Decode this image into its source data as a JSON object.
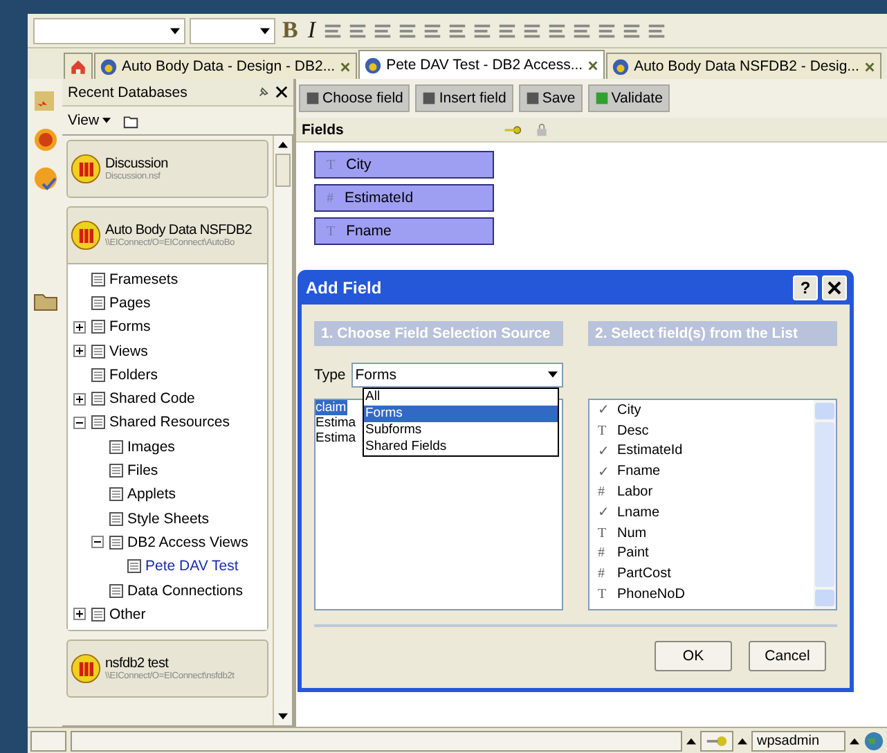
{
  "toolbar": {
    "format_buttons": [
      {
        "label": "B",
        "kind": "bold"
      },
      {
        "label": "I",
        "kind": "italic"
      }
    ]
  },
  "tabs": [
    {
      "label": "Auto Body Data - Design - DB2...",
      "selected": false
    },
    {
      "label": "Pete DAV Test - DB2 Access...",
      "selected": true
    },
    {
      "label": "Auto Body Data NSFDB2 - Desig...",
      "selected": false
    }
  ],
  "recent_databases": {
    "title": "Recent Databases",
    "view_menu": "View",
    "databases": [
      {
        "name": "Discussion",
        "path": "Discussion.nsf",
        "expanded": false
      },
      {
        "name": "Auto Body Data NSFDB2",
        "path": "\\\\EIConnect/O=EIConnect\\AutoBo",
        "expanded": true,
        "tree": [
          {
            "label": "Framesets",
            "selected": false
          },
          {
            "label": "Pages",
            "selected": false
          },
          {
            "label": "Forms",
            "selected": false,
            "expanded": false
          },
          {
            "label": "Views",
            "selected": false,
            "expanded": false
          },
          {
            "label": "Folders",
            "selected": false
          },
          {
            "label": "Shared Code",
            "selected": false,
            "expanded": false
          },
          {
            "label": "Shared Resources",
            "selected": false,
            "expanded": true,
            "children": [
              {
                "label": "Images",
                "selected": false
              },
              {
                "label": "Files",
                "selected": false
              },
              {
                "label": "Applets",
                "selected": false
              },
              {
                "label": "Style Sheets",
                "selected": false
              },
              {
                "label": "DB2 Access Views",
                "selected": false,
                "expanded": true,
                "children": [
                  {
                    "label": "Pete DAV Test",
                    "selected": true
                  }
                ]
              },
              {
                "label": "Data Connections",
                "selected": false
              }
            ]
          },
          {
            "label": "Other",
            "selected": false,
            "expanded": false
          }
        ]
      },
      {
        "name": "nsfdb2 test",
        "path": "\\\\EIConnect/O=EIConnect\\nsfdb2t",
        "expanded": false
      }
    ]
  },
  "design": {
    "buttons": [
      "Choose field",
      "Insert field",
      "Save",
      "Validate"
    ],
    "fields_header": "Fields",
    "fields": [
      {
        "icon": "T",
        "name": "City"
      },
      {
        "icon": "#",
        "name": "EstimateId"
      },
      {
        "icon": "T",
        "name": "Fname"
      }
    ]
  },
  "dialog": {
    "title": "Add Field",
    "help": "?",
    "source_header": "1. Choose Field Selection Source",
    "list_header": "2. Select field(s) from the List",
    "type_label": "Type",
    "type_value": "Forms",
    "type_options": [
      {
        "label": "All",
        "selected": false
      },
      {
        "label": "Forms",
        "selected": true
      },
      {
        "label": "Subforms",
        "selected": false
      },
      {
        "label": "Shared Fields",
        "selected": false
      }
    ],
    "sources": [
      {
        "label": "claim",
        "selected": true
      },
      {
        "label": "Estima",
        "selected": false
      },
      {
        "label": "Estima",
        "selected": false
      }
    ],
    "fields": [
      {
        "icon": "✓",
        "name": "City"
      },
      {
        "icon": "T",
        "name": "Desc"
      },
      {
        "icon": "✓",
        "name": "EstimateId"
      },
      {
        "icon": "✓",
        "name": "Fname"
      },
      {
        "icon": "#",
        "name": "Labor"
      },
      {
        "icon": "✓",
        "name": "Lname"
      },
      {
        "icon": "T",
        "name": "Num"
      },
      {
        "icon": "#",
        "name": "Paint"
      },
      {
        "icon": "#",
        "name": "PartCost"
      },
      {
        "icon": "T",
        "name": "PhoneNoD"
      }
    ],
    "buttons": [
      "OK",
      "Cancel"
    ]
  },
  "status_bar": {
    "user": "wpsadmin"
  }
}
